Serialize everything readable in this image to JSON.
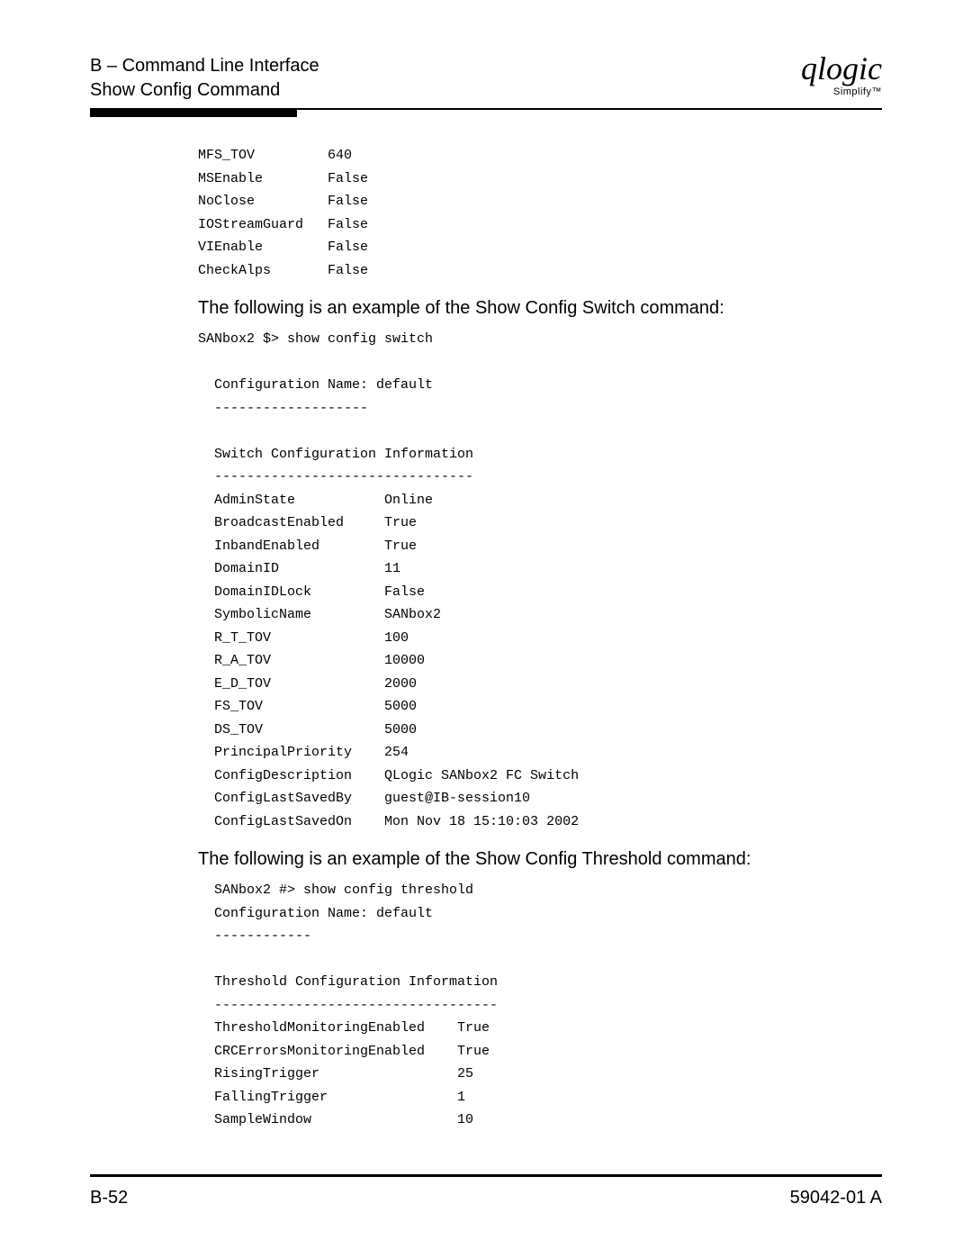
{
  "header": {
    "line1": "B – Command Line Interface",
    "line2": "Show Config Command"
  },
  "logo": {
    "script": "qlogic",
    "sub": "Simplify™"
  },
  "port_config_tail": "MFS_TOV         640\nMSEnable        False\nNoClose         False\nIOStreamGuard   False\nVIEnable        False\nCheckAlps       False",
  "switch_intro": "The following is an example of the Show Config Switch command:",
  "switch_block": "SANbox2 $> show config switch\n\n  Configuration Name: default\n  -------------------\n\n  Switch Configuration Information\n  --------------------------------\n  AdminState           Online\n  BroadcastEnabled     True\n  InbandEnabled        True\n  DomainID             11\n  DomainIDLock         False\n  SymbolicName         SANbox2\n  R_T_TOV              100\n  R_A_TOV              10000\n  E_D_TOV              2000\n  FS_TOV               5000\n  DS_TOV               5000\n  PrincipalPriority    254\n  ConfigDescription    QLogic SANbox2 FC Switch\n  ConfigLastSavedBy    guest@IB-session10\n  ConfigLastSavedOn    Mon Nov 18 15:10:03 2002",
  "threshold_intro": "The following is an example of the Show Config Threshold command:",
  "threshold_block": "  SANbox2 #> show config threshold\n  Configuration Name: default\n  ------------\n\n  Threshold Configuration Information\n  -----------------------------------\n  ThresholdMonitoringEnabled    True\n  CRCErrorsMonitoringEnabled    True\n  RisingTrigger                 25\n  FallingTrigger                1\n  SampleWindow                  10",
  "footer": {
    "left": "B-52",
    "right": "59042-01 A"
  }
}
